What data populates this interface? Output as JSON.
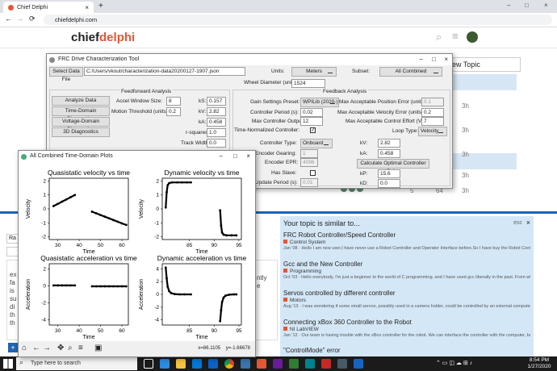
{
  "browser": {
    "tab_title": "Chief Delphi",
    "url": "chiefdelphi.com"
  },
  "site": {
    "logo_left": "chief",
    "logo_right": "delphi",
    "new_topic": "ew Topic",
    "times": [
      "3h",
      "3h",
      "3h",
      "3h",
      "3h"
    ],
    "row_counts": [
      "5",
      "64"
    ]
  },
  "similar": {
    "heading": "Your topic is similar to...",
    "esc": "esc",
    "items": [
      {
        "title": "FRC Robot Controller/Speed Controller",
        "category": "Control System",
        "excerpt": "Jan '08 · Hello I am new user,I have never use a Robot Controller and Operator Interface before.So I have buy the Robot Controller and Operator Interface from http://ifrobotics.com/robot..."
      },
      {
        "title": "Gcc and the New Controller",
        "category": "Programming",
        "excerpt": "Oct '03 · Hello everybody, I'm just a beginner to the world of C programming, and I have used gcc liberally in the past. From what I have heard so far, the new Robot Controller/EDU controller can only be pro..."
      },
      {
        "title": "Servos controlled by different controller",
        "category": "Motors",
        "excerpt": "Aug '13 · I was wondering if some small servos, possibly used in a camera holder, could be controlled by an external computer like a propeller chip or raspberry pi. Is there a maximum wattage rating that can..."
      },
      {
        "title": "Connecting xBox 360 Controller to the Robot",
        "category": "NI LabVIEW",
        "excerpt": "Jan '12 · Our team is having trouble with the xBox controller for the robot. We can interface the controller with the computer, but it is not compatible with the cRIO. How would we go about making the contro..."
      },
      {
        "title": "\"ControlMode\" error",
        "category": "",
        "excerpt": ""
      }
    ]
  },
  "composer": {
    "left_text": [
      "ex",
      "fa",
      "is",
      "su",
      "di",
      "th",
      "th",
      "(u"
    ],
    "right_text": [
      "ntly",
      "e"
    ]
  },
  "taskbar": {
    "search": "Type here to search",
    "time": "8:54 PM",
    "date": "1/27/2020"
  },
  "tool": {
    "title": "FRC Drive Characterization Tool",
    "select_file": "Select Data File",
    "file_path": "C:/Users/vkout/characterization-data20200127-1907.json",
    "units_label": "Units:",
    "units_value": "Meters",
    "subset_label": "Subset:",
    "subset_value": "All Combined",
    "wheel_label": "Wheel Diameter (units):",
    "wheel_value": "1524",
    "ff_heading": "Feedforward Analysis",
    "fb_heading": "Feedback Analysis",
    "analyze": "Analyze Data",
    "td_diag": "Time-Domain Diagnostics",
    "vd_diag": "Voltage-Domain Diagnostics",
    "diag_3d": "3D Diagnostics",
    "accel_window_label": "Accel Window Size:",
    "accel_window_value": "8",
    "motion_thresh_label": "Motion Threshold (units/s):",
    "motion_thresh_value": "0.2",
    "ks_label": "kS:",
    "ks_value": "0.157",
    "kv_label": "kV:",
    "kv_value": "2.82",
    "ka_label": "kA:",
    "ka_value": "0.458",
    "r2_label": "r-squared:",
    "r2_value": "1.0",
    "track_label": "Track Width:",
    "track_value": "0.0",
    "gain_preset_label": "Gain Settings Preset:",
    "gain_preset_value": "WPILib (2020-)",
    "ctrl_period_label": "Controller Period (s):",
    "ctrl_period_value": "0.02",
    "max_out_label": "Max Controller Output:",
    "max_out_value": "12",
    "time_norm_label": "Time-Normalized Controller:",
    "ctrl_type_label": "Controller Type:",
    "ctrl_type_value": "Onboard",
    "enc_gear_label": "Encoder Gearing:",
    "enc_gear_value": "1",
    "enc_epr_label": "Encoder EPR:",
    "enc_epr_value": "4096",
    "has_slave_label": "Has Slave:",
    "upd_period_label": "Update Period (s):",
    "upd_period_value": "0.01",
    "max_pos_err_label": "Max Acceptable Position Error (units):",
    "max_pos_err_value": "0.1",
    "max_vel_err_label": "Max Acceptable Velocity Error (units/s):",
    "max_vel_err_value": "0.2",
    "max_effort_label": "Max Acceptable Control Effort (V):",
    "max_effort_value": "7",
    "loop_type_label": "Loop Type:",
    "loop_type_value": "Velocity",
    "fb_kv_label": "kV:",
    "fb_kv_value": "2.82",
    "fb_ka_label": "kA:",
    "fb_ka_value": "0.458",
    "calc_gains": "Calculate Optimal Controller Gains",
    "kp_label": "kP:",
    "kp_value": "15.6",
    "kd_label": "kD:",
    "kd_value": "0.0"
  },
  "plots": {
    "window_title": "All Combined Time-Domain Plots",
    "status": "x=86.1105    y=-1.66678",
    "panels": [
      {
        "title": "Quasistatic velocity vs time",
        "ylabel": "Velocity",
        "xlabel": "Time",
        "xticks": [
          "30",
          "40",
          "50",
          "60"
        ],
        "yticks": [
          "2",
          "1",
          "0",
          "-1",
          "-2"
        ]
      },
      {
        "title": "Dynamic velocity vs time",
        "ylabel": "Velocity",
        "xlabel": "Time",
        "xticks": [
          "85",
          "90",
          "95"
        ],
        "yticks": [
          "2",
          "1",
          "0",
          "-1",
          "-2"
        ]
      },
      {
        "title": "Quasistatic acceleration vs time",
        "ylabel": "Acceleration",
        "xlabel": "Time",
        "xticks": [
          "30",
          "40",
          "50",
          "60"
        ],
        "yticks": [
          "2",
          "0",
          "-2",
          "-4"
        ]
      },
      {
        "title": "Dynamic acceleration vs time",
        "ylabel": "Acceleration",
        "xlabel": "Time",
        "xticks": [
          "85",
          "90",
          "95"
        ],
        "yticks": [
          "4",
          "2",
          "0",
          "-2",
          "-4"
        ]
      }
    ]
  },
  "chart_data": [
    {
      "type": "scatter",
      "title": "Quasistatic velocity vs time",
      "xlabel": "Time",
      "ylabel": "Velocity",
      "xlim": [
        26,
        63
      ],
      "ylim": [
        -2.2,
        2.2
      ],
      "series": [
        {
          "x": [
            28,
            30,
            32,
            34,
            36,
            38
          ],
          "y": [
            0.2,
            0.36,
            0.52,
            0.68,
            0.84,
            1.0
          ]
        },
        {
          "x": [
            46,
            48,
            50,
            52,
            54,
            56,
            58,
            60,
            62
          ],
          "y": [
            -0.2,
            -0.32,
            -0.44,
            -0.56,
            -0.68,
            -0.8,
            -0.92,
            -1.04,
            -1.15
          ]
        }
      ]
    },
    {
      "type": "scatter",
      "title": "Dynamic velocity vs time",
      "xlabel": "Time",
      "ylabel": "Velocity",
      "xlim": [
        79.5,
        95.5
      ],
      "ylim": [
        -2.2,
        2.2
      ],
      "series": [
        {
          "x": [
            80.2,
            80.4,
            80.6,
            80.9,
            81.5,
            82.5,
            83.5,
            84.5,
            85.3
          ],
          "y": [
            0.1,
            1.2,
            1.7,
            1.85,
            1.9,
            1.9,
            1.9,
            1.9,
            1.9
          ]
        },
        {
          "x": [
            91.2,
            91.4,
            91.6,
            91.9,
            92.5,
            93.5,
            94.5
          ],
          "y": [
            -0.1,
            -1.2,
            -1.7,
            -1.85,
            -1.9,
            -1.9,
            -1.9
          ]
        }
      ]
    },
    {
      "type": "scatter",
      "title": "Quasistatic acceleration vs time",
      "xlabel": "Time",
      "ylabel": "Acceleration",
      "xlim": [
        26,
        63
      ],
      "ylim": [
        -4.6,
        2.6
      ],
      "series": [
        {
          "x": [
            28,
            30,
            32,
            34,
            36,
            38
          ],
          "y": [
            0.05,
            0.05,
            0.05,
            0.05,
            0.05,
            0.05
          ]
        },
        {
          "x": [
            46,
            48,
            50,
            52,
            54,
            56,
            58,
            60,
            62
          ],
          "y": [
            -0.05,
            -0.05,
            -0.05,
            -0.05,
            -0.05,
            -0.05,
            -0.05,
            -0.05,
            -0.05
          ]
        }
      ]
    },
    {
      "type": "scatter",
      "title": "Dynamic acceleration vs time",
      "xlabel": "Time",
      "ylabel": "Acceleration",
      "xlim": [
        79.5,
        95.5
      ],
      "ylim": [
        -4.8,
        4.8
      ],
      "series": [
        {
          "x": [
            80.2,
            80.4,
            80.6,
            80.9,
            81.3,
            82,
            83,
            84,
            85.3
          ],
          "y": [
            4.2,
            2.5,
            1.2,
            0.5,
            0.2,
            0.05,
            0,
            0,
            0
          ]
        },
        {
          "x": [
            91.2,
            91.4,
            91.6,
            91.9,
            92.3,
            93,
            94,
            94.5
          ],
          "y": [
            -4.2,
            -2.5,
            -1.2,
            -0.5,
            -0.2,
            -0.05,
            0,
            0
          ]
        }
      ]
    }
  ],
  "colors": {
    "brand": "#e45735",
    "link": "#1f63b0",
    "similar_bg": "#d4e7f7",
    "taskbar": "#1b1b1b"
  }
}
